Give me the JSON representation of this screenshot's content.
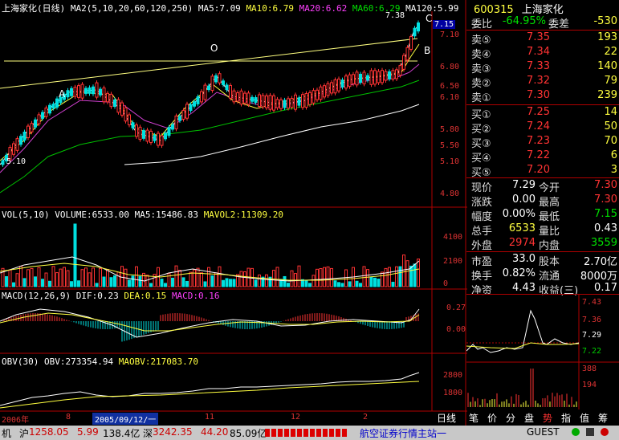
{
  "header": {
    "title": "上海家化(日线)",
    "ma_params": "MA2(5,10,20,60,120,250)",
    "ma5": "MA5:7.09",
    "ma10": "MA10:6.79",
    "ma20": "MA20:6.62",
    "ma60": "MA60:6.29",
    "ma120": "MA120:5.99"
  },
  "chart": {
    "labels": {
      "a": "A",
      "o": "O",
      "b": "B",
      "c": "C"
    },
    "peak_value": "7.38",
    "low_value": "5.10",
    "current_tag": "7.15",
    "price_ticks": [
      "7.10",
      "6.80",
      "6.50",
      "6.10",
      "5.80",
      "5.50",
      "5.10",
      "4.80"
    ],
    "vol_header": {
      "title": "VOL(5,10)",
      "volume": "VOLUME:6533.00",
      "ma5": "MA5:15486.83",
      "mavol2": "MAVOL2:11309.20"
    },
    "vol_ticks": [
      "4100",
      "2100",
      "0"
    ],
    "macd_header": {
      "title": "MACD(12,26,9)",
      "dif": "DIF:0.23",
      "dea": "DEA:0.15",
      "macd": "MACD:0.16"
    },
    "macd_ticks": [
      "0.27",
      "0.00"
    ],
    "obv_header": {
      "title": "OBV(30)",
      "obv": "OBV:273354.94",
      "maobv": "MAOBV:217083.70"
    },
    "obv_ticks": [
      "2800",
      "1800"
    ],
    "date_axis": [
      "2006年",
      "8",
      "2005/09/12/一",
      "11",
      "12",
      "2"
    ]
  },
  "quote": {
    "code": "600315",
    "name": "上海家化",
    "weibi_label": "委比",
    "weibi": "-64.95%",
    "weicha_label": "委差",
    "weicha": "-530",
    "sells": [
      {
        "label": "卖⑤",
        "price": "7.35",
        "vol": "193"
      },
      {
        "label": "卖④",
        "price": "7.34",
        "vol": "22"
      },
      {
        "label": "卖③",
        "price": "7.33",
        "vol": "140"
      },
      {
        "label": "卖②",
        "price": "7.32",
        "vol": "79"
      },
      {
        "label": "卖①",
        "price": "7.30",
        "vol": "239"
      }
    ],
    "buys": [
      {
        "label": "买①",
        "price": "7.25",
        "vol": "14"
      },
      {
        "label": "买②",
        "price": "7.24",
        "vol": "50"
      },
      {
        "label": "买③",
        "price": "7.23",
        "vol": "70"
      },
      {
        "label": "买④",
        "price": "7.22",
        "vol": "6"
      },
      {
        "label": "买⑤",
        "price": "7.20",
        "vol": "3"
      }
    ],
    "stats": [
      {
        "l1": "现价",
        "v1": "7.29",
        "l2": "今开",
        "v2": "7.30"
      },
      {
        "l1": "涨跌",
        "v1": "0.00",
        "l2": "最高",
        "v2": "7.30"
      },
      {
        "l1": "幅度",
        "v1": "0.00%",
        "l2": "最低",
        "v2": "7.15"
      },
      {
        "l1": "总手",
        "v1": "6533",
        "l2": "量比",
        "v2": "0.43"
      },
      {
        "l1": "外盘",
        "v1": "2974",
        "l2": "内盘",
        "v2": "3559"
      }
    ],
    "fund": [
      {
        "l1": "市盈",
        "v1": "33.0",
        "l2": "股本",
        "v2": "2.70亿"
      },
      {
        "l1": "换手",
        "v1": "0.82%",
        "l2": "流通",
        "v2": "8000万"
      },
      {
        "l1": "净资",
        "v1": "4.43",
        "l2": "收益(三)",
        "v2": "0.17"
      }
    ]
  },
  "mini": {
    "ticks": [
      "7.43",
      "7.36",
      "7.29",
      "7.22"
    ],
    "vol_ticks": [
      "388",
      "194"
    ]
  },
  "func_tabs": [
    "笔",
    "价",
    "分",
    "盘",
    "势",
    "指",
    "值",
    "筹"
  ],
  "daily_tab": "日线",
  "bottom_bar": {
    "prefix": "机",
    "sh_label": "沪",
    "sh_index": "1258.05",
    "sh_change": "5.99",
    "sh_amount": "138.4亿",
    "sz_label": "深",
    "sz_index": "3242.35",
    "sz_change": "44.20",
    "sz_amount": "85.09亿",
    "news": "航空证券行情主站一",
    "user": "GUEST"
  },
  "colors": {
    "up": "#ff3333",
    "down": "#00e0e0",
    "background": "#000000",
    "axis": "#b00000"
  }
}
